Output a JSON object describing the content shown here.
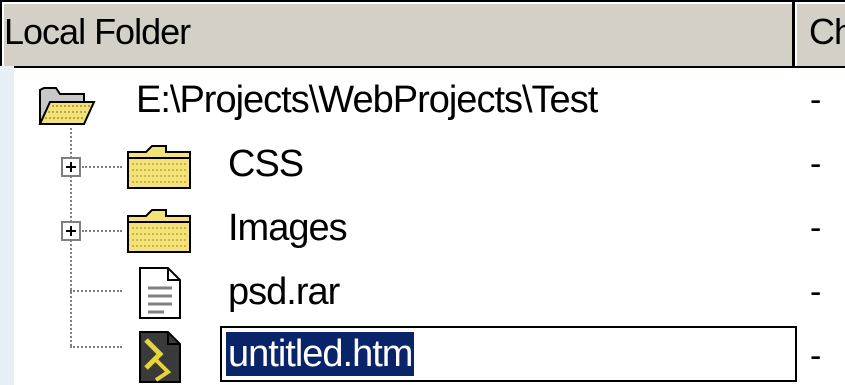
{
  "columns": {
    "local_folder": "Local Folder",
    "checked": "Ch"
  },
  "tree": {
    "root": {
      "label": "E:\\Projects\\WebProjects\\Test",
      "status": "-",
      "icon": "open-folder-icon"
    },
    "items": [
      {
        "label": "CSS",
        "status": "-",
        "icon": "folder-icon",
        "expandable": true
      },
      {
        "label": "Images",
        "status": "-",
        "icon": "folder-icon",
        "expandable": true
      },
      {
        "label": "psd.rar",
        "status": "-",
        "icon": "document-icon",
        "expandable": false
      },
      {
        "label": "untitled.htm",
        "status": "-",
        "icon": "html-file-icon",
        "expandable": false,
        "renaming": true
      }
    ]
  },
  "colors": {
    "header_bg": "#d4d0c8",
    "selection_bg": "#0a246a",
    "folder_yellow": "#f3e27a"
  }
}
